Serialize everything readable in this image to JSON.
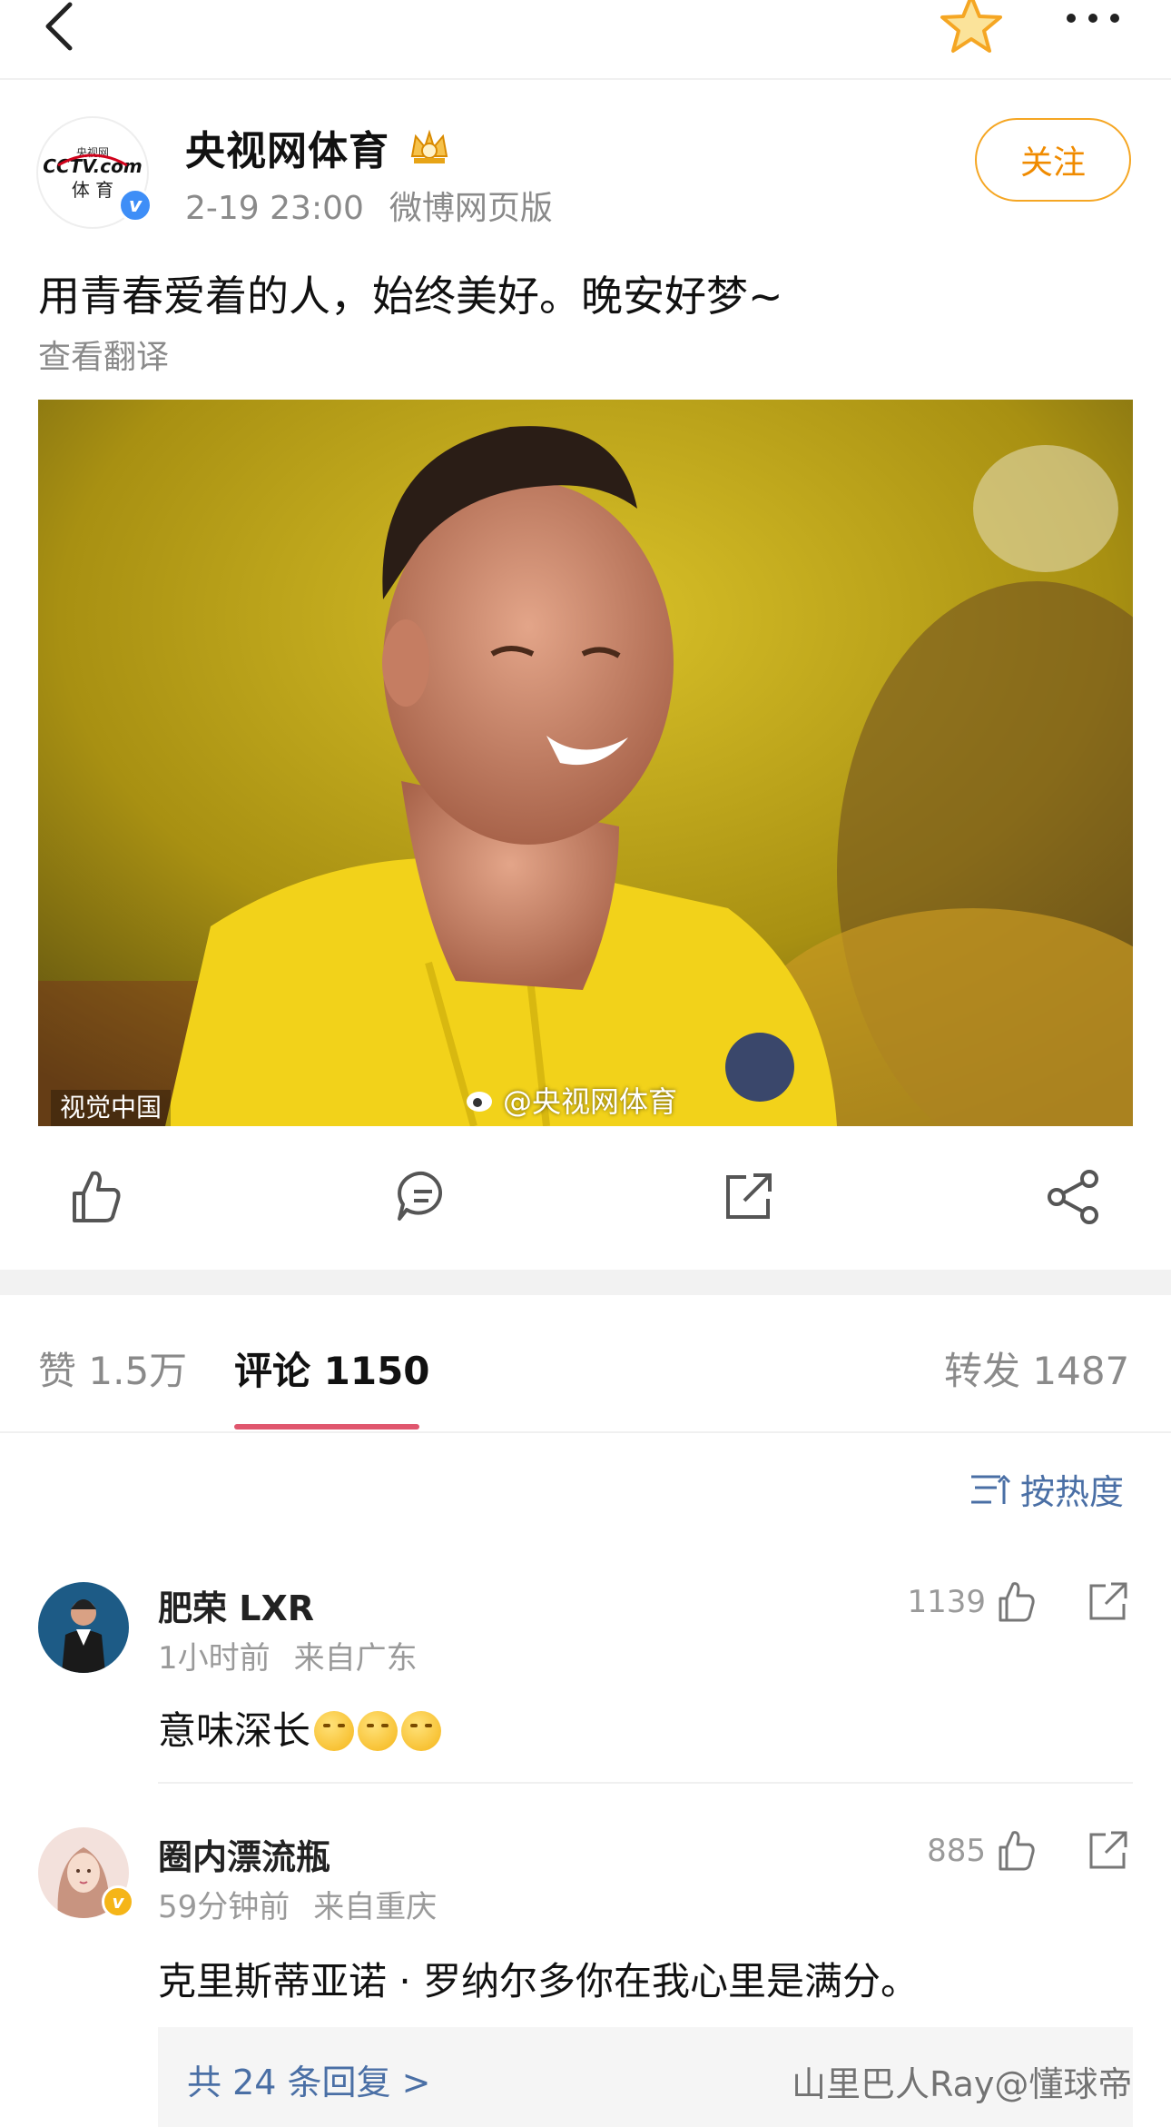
{
  "post": {
    "author": "央视网体育",
    "timestamp": "2-19 23:00",
    "source": "微博网页版",
    "follow_label": "关注",
    "text": "用青春爱着的人，始终美好。晚安好梦~",
    "translate_label": "查看翻译",
    "avatar_logo_top": "CCTV.com",
    "avatar_logo_cn": "央视网",
    "avatar_logo_sub": "体 育",
    "image_credit": "视觉中国",
    "image_watermark": "@央视网体育"
  },
  "tabs": [
    {
      "label": "赞",
      "count": "1.5万"
    },
    {
      "label": "评论",
      "count": "1150"
    },
    {
      "label": "转发",
      "count": "1487"
    }
  ],
  "sort_label": "按热度",
  "comments": [
    {
      "name": "肥荣 LXR",
      "time": "1小时前",
      "location": "来自广东",
      "text": "意味深长",
      "likes": "1139"
    },
    {
      "name": "圈内漂流瓶",
      "time": "59分钟前",
      "location": "来自重庆",
      "text": "克里斯蒂亚诺 · 罗纳尔多你在我心里是满分。",
      "likes": "885",
      "replies_label": "共 24 条回复 >"
    }
  ],
  "watermark": "山里巴人Ray@懂球帝",
  "colors": {
    "accent_orange": "#f5a623",
    "tab_underline": "#e0566e",
    "link_blue": "#4a6fa5",
    "verified_blue": "#3e8ef7"
  },
  "icons": [
    "back-icon",
    "star-icon",
    "more-icon",
    "crown-icon",
    "like-icon",
    "comment-icon",
    "repost-icon",
    "share-icon",
    "sort-icon"
  ]
}
